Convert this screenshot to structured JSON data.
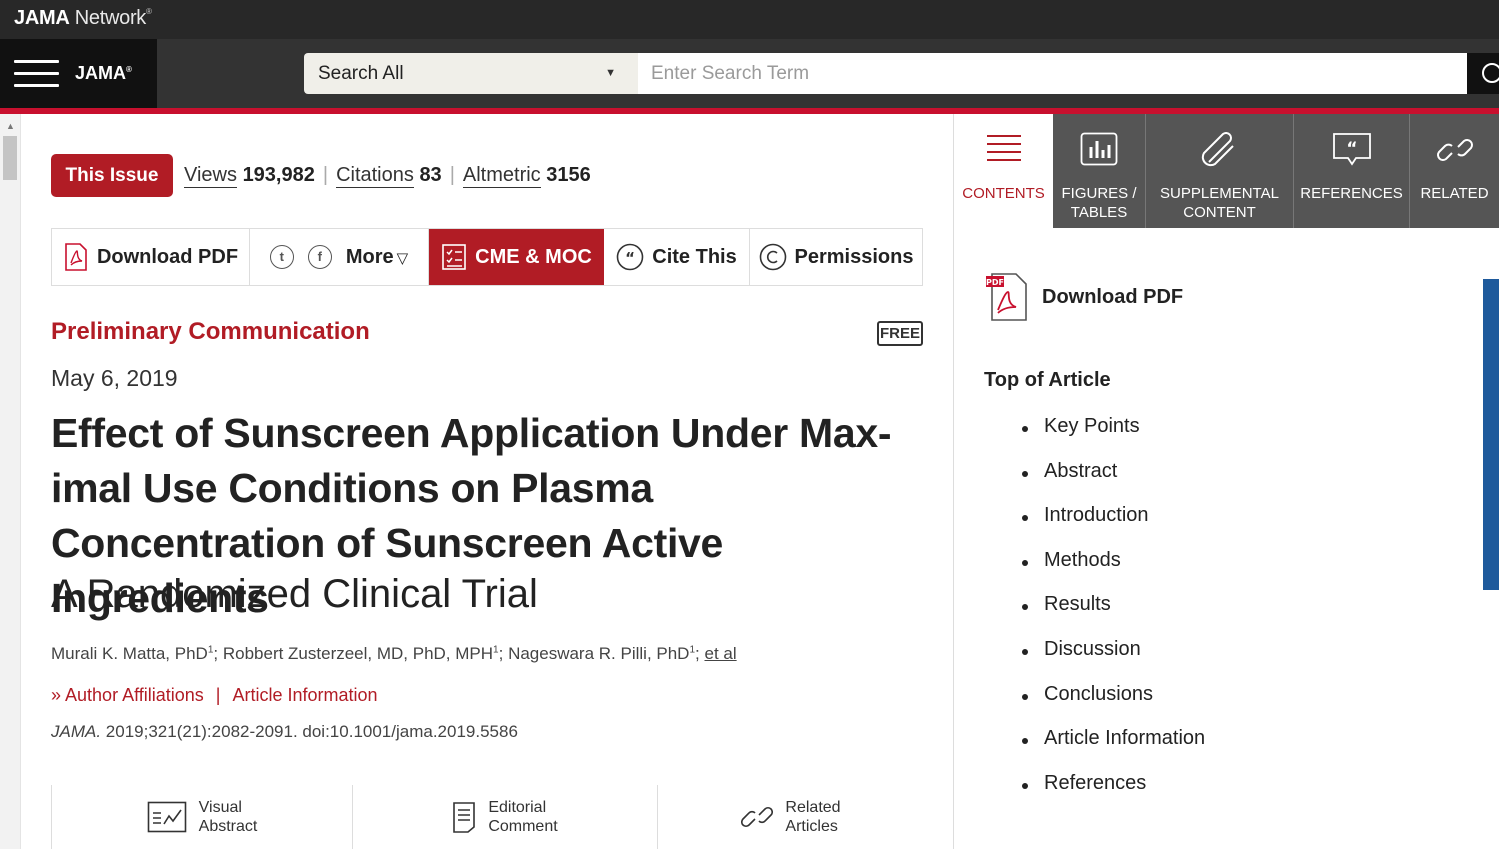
{
  "topbar": {
    "brand_bold": "JAMA",
    "brand_light": "Network",
    "brand_tm": "®"
  },
  "navbar": {
    "logo": "JAMA",
    "logo_mark": "®",
    "search_scope": "Search All",
    "search_placeholder": "Enter Search Term"
  },
  "issue": {
    "this_issue_label": "This Issue",
    "metrics": [
      {
        "label": "Views",
        "value": "193,982"
      },
      {
        "label": "Citations",
        "value": "83"
      },
      {
        "label": "Altmetric",
        "value": "3156"
      }
    ]
  },
  "toolbar": {
    "download_pdf": "Download PDF",
    "twitter_glyph": "t",
    "facebook_glyph": "f",
    "more": "More",
    "cme": "CME & MOC",
    "cite": "Cite This",
    "permissions": "Permissions"
  },
  "article": {
    "category": "Preliminary Communication",
    "free_badge": "FREE",
    "date": "May 6, 2019",
    "title": "Effect of Sunscreen Application Under Max-imal Use Conditions on Plasma Concentration of Sunscreen Active Ingredients",
    "subtitle": "A Randomized Clinical Trial",
    "authors": [
      {
        "name": "Murali K. Matta, PhD",
        "sup": "1"
      },
      {
        "name": "Robbert Zusterzeel, MD, PhD, MPH",
        "sup": "1"
      },
      {
        "name": "Nageswara R. Pilli, PhD",
        "sup": "1"
      }
    ],
    "et_al": "et al",
    "author_affiliations": "Author Affiliations",
    "article_information": "Article Information",
    "journal": "JAMA.",
    "citation_rest": "2019;321(21):2082-2091. doi:10.1001/jama.2019.5586"
  },
  "bottom_links": [
    {
      "line1": "Visual",
      "line2": "Abstract"
    },
    {
      "line1": "Editorial",
      "line2": "Comment"
    },
    {
      "line1": "Related",
      "line2": "Articles"
    }
  ],
  "sidebar": {
    "tabs": [
      {
        "line1": "CONTENTS",
        "line2": ""
      },
      {
        "line1": "FIGURES /",
        "line2": "TABLES"
      },
      {
        "line1": "SUPPLEMENTAL",
        "line2": "CONTENT"
      },
      {
        "line1": "REFERENCES",
        "line2": ""
      },
      {
        "line1": "RELATED",
        "line2": ""
      }
    ],
    "download_pdf": "Download PDF",
    "pdf_icon_text": "PDF",
    "toc_heading": "Top of Article",
    "toc": [
      "Key Points",
      "Abstract",
      "Introduction",
      "Methods",
      "Results",
      "Discussion",
      "Conclusions",
      "Article Information",
      "References"
    ]
  },
  "colors": {
    "accent": "#b11c25",
    "topbar": "#282828",
    "navbar": "#333333",
    "tab_gray": "#555555",
    "scroll_blue": "#1e5a9c"
  }
}
